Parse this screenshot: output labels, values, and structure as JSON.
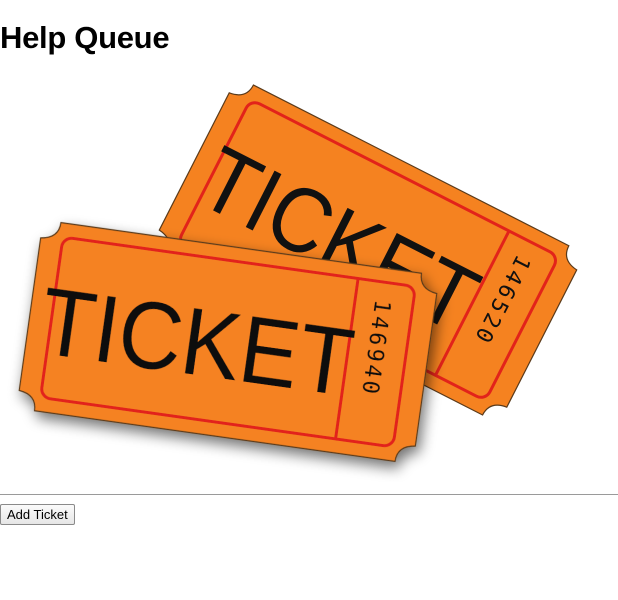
{
  "header": {
    "title": "Help Queue"
  },
  "hero_image": {
    "icon": "tickets-illustration-icon",
    "back_ticket": {
      "label": "TICKET",
      "number": "146520"
    },
    "front_ticket": {
      "label": "TICKET",
      "number": "146940"
    },
    "colors": {
      "ticket_fill": "#f58220",
      "ticket_border": "#e2231a",
      "ink": "#111111"
    }
  },
  "actions": {
    "add_ticket_label": "Add Ticket"
  }
}
